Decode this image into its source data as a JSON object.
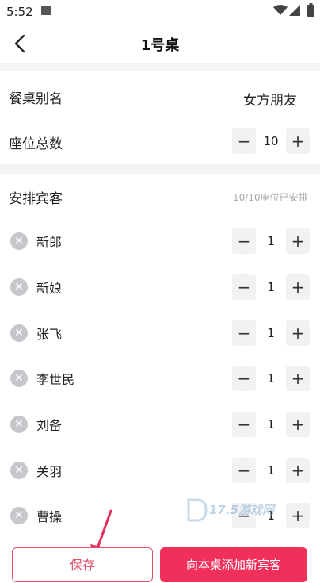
{
  "status_bar": {
    "time": "5:52"
  },
  "header": {
    "title": "1号桌"
  },
  "table_alias": {
    "label": "餐桌别名",
    "value": "女方朋友"
  },
  "seat_total": {
    "label": "座位总数",
    "value": "10"
  },
  "arrange": {
    "label": "安排宾客",
    "status": "10/10座位已安排"
  },
  "guests": [
    {
      "name": "新郎",
      "count": "1"
    },
    {
      "name": "新娘",
      "count": "1"
    },
    {
      "name": "张飞",
      "count": "1"
    },
    {
      "name": "李世民",
      "count": "1"
    },
    {
      "name": "刘备",
      "count": "1"
    },
    {
      "name": "关羽",
      "count": "1"
    },
    {
      "name": "曹操",
      "count": "1"
    }
  ],
  "stepper_symbols": {
    "minus": "−",
    "plus": "+"
  },
  "watermark": {
    "text": "17.5游戏网"
  },
  "buttons": {
    "save": "保存",
    "add_guest": "向本桌添加新宾客"
  },
  "colors": {
    "accent": "#f0305a",
    "outline": "#e0506b",
    "gap": "#f4f4f6"
  }
}
